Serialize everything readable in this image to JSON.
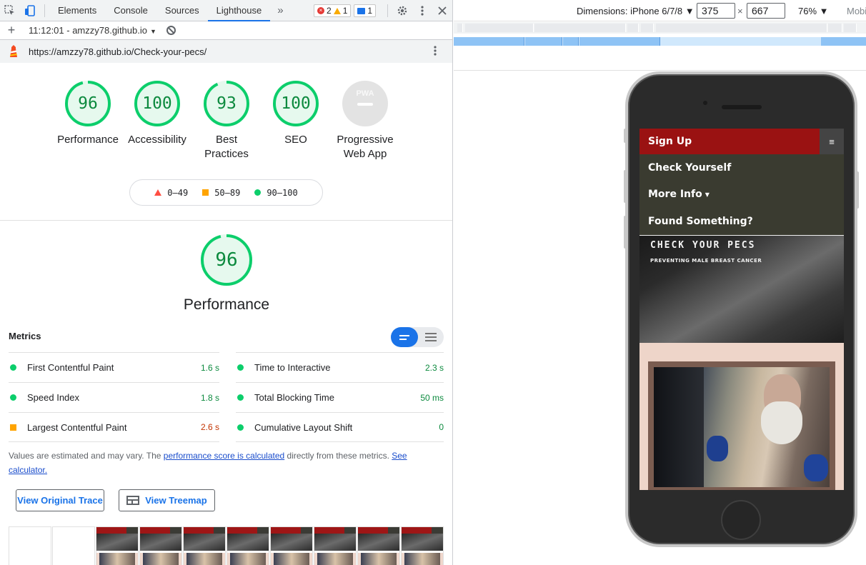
{
  "devtools": {
    "tabs": [
      "Elements",
      "Console",
      "Sources",
      "Lighthouse"
    ],
    "active_tab": "Lighthouse",
    "more_tabs": "»",
    "badges": {
      "errors": "2",
      "warnings": "1",
      "messages": "1"
    },
    "report_selector": "11:12:01 - amzzy78.github.io",
    "url": "https://amzzy78.github.io/Check-your-pecs/"
  },
  "gauges": [
    {
      "score": "96",
      "label": "Performance",
      "fraction": 0.96,
      "color": "#0cce6b"
    },
    {
      "score": "100",
      "label": "Accessibility",
      "fraction": 1.0,
      "color": "#0cce6b"
    },
    {
      "score": "93",
      "label": "Best Practices",
      "fraction": 0.93,
      "color": "#0cce6b"
    },
    {
      "score": "100",
      "label": "SEO",
      "fraction": 1.0,
      "color": "#0cce6b"
    },
    {
      "score": "",
      "label": "Progressive Web App",
      "badge_text": "PWA",
      "color": "#dadce0"
    }
  ],
  "legend": [
    {
      "range": "0–49",
      "shape": "triangle",
      "color": "#ff4e42"
    },
    {
      "range": "50–89",
      "shape": "square",
      "color": "#ffa400"
    },
    {
      "range": "90–100",
      "shape": "circle",
      "color": "#0cce6b"
    }
  ],
  "performance": {
    "score": "96",
    "fraction": 0.96,
    "title": "Performance",
    "metrics_heading": "Metrics",
    "metrics_left": [
      {
        "name": "First Contentful Paint",
        "value": "1.6 s",
        "status": "green"
      },
      {
        "name": "Speed Index",
        "value": "1.8 s",
        "status": "green"
      },
      {
        "name": "Largest Contentful Paint",
        "value": "2.6 s",
        "status": "orange"
      }
    ],
    "metrics_right": [
      {
        "name": "Time to Interactive",
        "value": "2.3 s",
        "status": "green"
      },
      {
        "name": "Total Blocking Time",
        "value": "50 ms",
        "status": "green"
      },
      {
        "name": "Cumulative Layout Shift",
        "value": "0",
        "status": "green"
      }
    ],
    "note_pre": "Values are estimated and may vary. The ",
    "note_link1": "performance score is calculated",
    "note_mid": " directly from these metrics. ",
    "note_link2": "See calculator.",
    "button_trace": "View Original Trace",
    "button_treemap": "View Treemap",
    "thumbnail_count": 10,
    "thumbnail_label": "Sign Up"
  },
  "device_toolbar": {
    "dimensions_label": "Dimensions: iPhone 6/7/8 ▼",
    "width": "375",
    "times": "×",
    "height": "667",
    "zoom": "76% ▼",
    "mode": "Mobile"
  },
  "site": {
    "signup": "Sign Up",
    "hamburger": "≡",
    "menu": [
      "Check Yourself",
      "More Info",
      "Found Something?"
    ],
    "dropdown_caret": "▼",
    "hero_title": "CHECK YOUR PECS",
    "hero_subtitle": "PREVENTING MALE BREAST CANCER"
  }
}
